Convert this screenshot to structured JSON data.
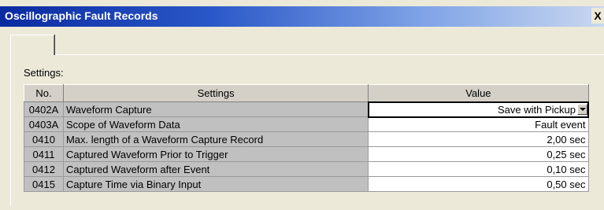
{
  "window": {
    "title": "Oscillographic Fault Records",
    "close_label": "X"
  },
  "tab": {
    "label": ""
  },
  "section": {
    "label": "Settings:"
  },
  "table": {
    "headers": [
      "No.",
      "Settings",
      "Value"
    ],
    "rows": [
      {
        "no": "0402A",
        "setting": "Waveform Capture",
        "value": "Save with Pickup",
        "dropdown": true
      },
      {
        "no": "0403A",
        "setting": "Scope of Waveform Data",
        "value": "Fault event"
      },
      {
        "no": "0410",
        "setting": "Max. length of a Waveform Capture Record",
        "value": "2,00 sec"
      },
      {
        "no": "0411",
        "setting": "Captured Waveform Prior to Trigger",
        "value": "0,25 sec"
      },
      {
        "no": "0412",
        "setting": "Captured Waveform after Event",
        "value": "0,10 sec"
      },
      {
        "no": "0415",
        "setting": "Capture Time via Binary Input",
        "value": "0,50 sec"
      }
    ]
  }
}
